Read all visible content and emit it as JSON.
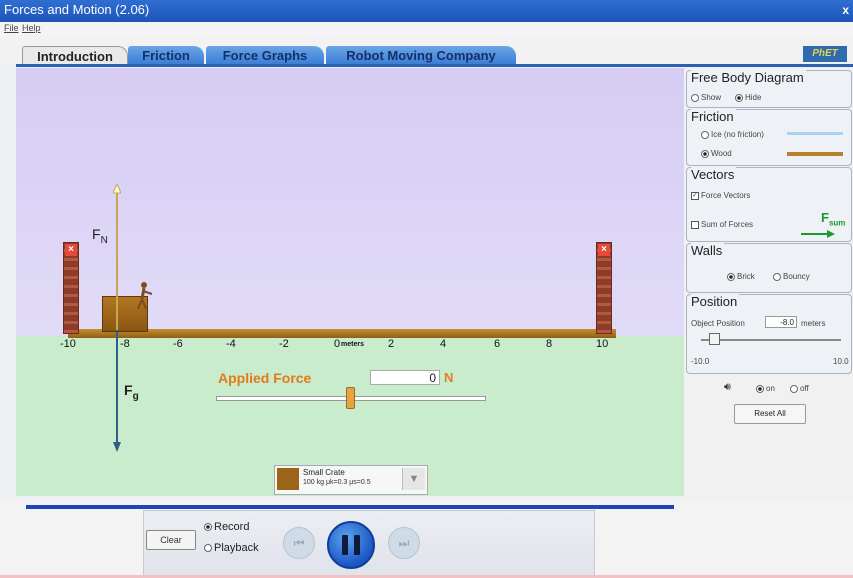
{
  "window": {
    "title": "Forces and Motion (2.06)",
    "close": "x"
  },
  "menu": {
    "file": "File",
    "help": "Help"
  },
  "tabs": [
    {
      "label": "Introduction",
      "active": true
    },
    {
      "label": "Friction",
      "active": false
    },
    {
      "label": "Force Graphs",
      "active": false
    },
    {
      "label": "Robot Moving Company",
      "active": false
    }
  ],
  "logo": "PhET",
  "scene": {
    "fn_label": "F",
    "fn_sub": "N",
    "fg_label": "F",
    "fg_sub": "g",
    "ticks": [
      "-10",
      "-8",
      "-6",
      "-4",
      "-2",
      "0",
      "2",
      "4",
      "6",
      "8",
      "10"
    ],
    "unit": "meters",
    "applied_force_label": "Applied Force",
    "applied_force_value": "0",
    "applied_force_unit": "N",
    "applied_force_level": 0.5,
    "object_name": "Small Crate",
    "object_props": "100 kg μk=0.3 μs=0.5"
  },
  "side": {
    "free_body": {
      "title": "Free Body Diagram",
      "show": "Show",
      "hide": "Hide",
      "selected": "hide"
    },
    "friction": {
      "title": "Friction",
      "ice": "Ice (no friction)",
      "wood": "Wood",
      "selected": "wood",
      "ice_color": "#a8d4f4",
      "wood_color": "#b5812b"
    },
    "vectors": {
      "title": "Vectors",
      "force_vectors": "Force Vectors",
      "force_vectors_checked": true,
      "sum_of_forces": "Sum of Forces",
      "sum_of_forces_checked": false,
      "sum_label": "F",
      "sum_sub": "sum",
      "sum_color": "#1a9c2c"
    },
    "walls": {
      "title": "Walls",
      "brick": "Brick",
      "bouncy": "Bouncy",
      "selected": "brick"
    },
    "position": {
      "title": "Position",
      "label": "Object Position",
      "value": "-8.0",
      "unit": "meters",
      "min": "-10.0",
      "max": "10.0"
    },
    "sound": {
      "on": "on",
      "off": "off",
      "selected": "on"
    },
    "reset": "Reset All"
  },
  "playback": {
    "clear": "Clear",
    "record": "Record",
    "playback": "Playback",
    "mode": "record"
  },
  "colors": {
    "title_bar": "#1d55b9",
    "tab_active": "#e9e9e9",
    "tab_inactive": "#3a7cd4",
    "applied_force": "#e27a18",
    "play_button": "#1a56c4"
  }
}
